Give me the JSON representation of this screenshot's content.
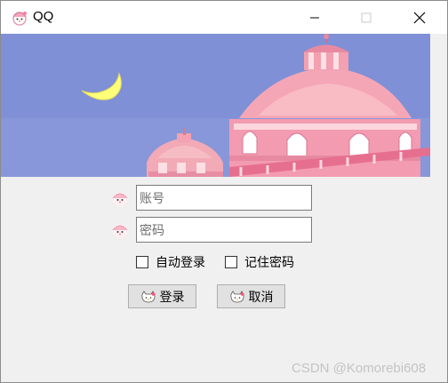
{
  "window": {
    "title": "QQ"
  },
  "titlebar": {
    "minimize_icon": "minimize-icon",
    "maximize_icon": "maximize-icon",
    "close_icon": "close-icon"
  },
  "banner": {
    "description_icon": "castle-banner-image"
  },
  "form": {
    "account": {
      "placeholder": "账号",
      "icon": "user-avatar-icon"
    },
    "password": {
      "placeholder": "密码",
      "icon": "lock-avatar-icon"
    },
    "auto_login": "自动登录",
    "remember_password": "记住密码"
  },
  "buttons": {
    "login": "登录",
    "cancel": "取消",
    "icon": "kitty-icon"
  },
  "watermark": "CSDN @Komorebi608",
  "colors": {
    "sky": "#7f90d6",
    "dome_pink": "#f4a1b1",
    "moon": "#ffff7a",
    "window_bg": "#f0f0f0"
  }
}
